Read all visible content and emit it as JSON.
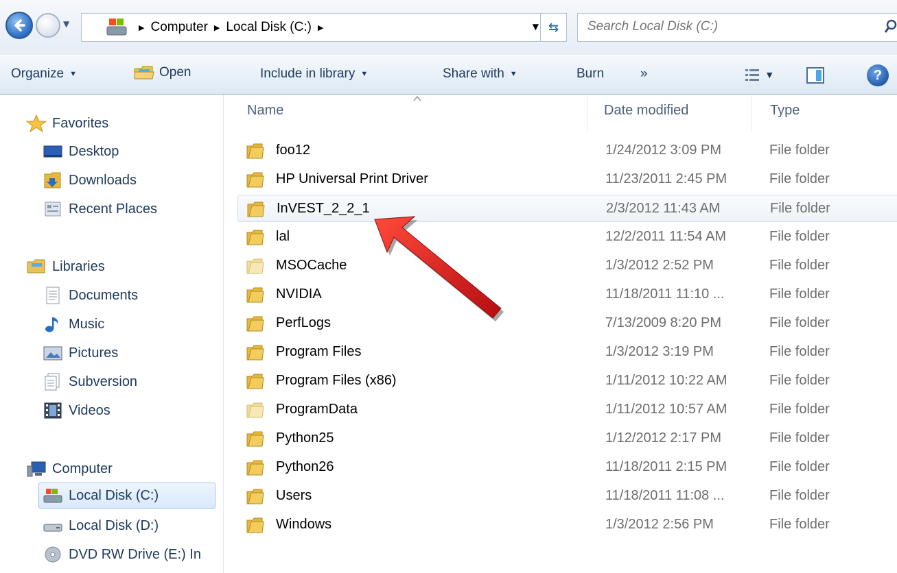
{
  "address_bar": {
    "breadcrumbs": [
      "Computer",
      "Local Disk (C:)"
    ],
    "search_placeholder": "Search Local Disk (C:)"
  },
  "toolbar": {
    "organize": "Organize",
    "open": "Open",
    "include_in_library": "Include in library",
    "share_with": "Share with",
    "burn": "Burn",
    "overflow": "»"
  },
  "nav_pane": {
    "favorites": {
      "label": "Favorites",
      "items": [
        {
          "label": "Desktop",
          "icon": "desktop-icon"
        },
        {
          "label": "Downloads",
          "icon": "downloads-icon"
        },
        {
          "label": "Recent Places",
          "icon": "recent-places-icon"
        }
      ]
    },
    "libraries": {
      "label": "Libraries",
      "items": [
        {
          "label": "Documents",
          "icon": "documents-icon"
        },
        {
          "label": "Music",
          "icon": "music-icon"
        },
        {
          "label": "Pictures",
          "icon": "pictures-icon"
        },
        {
          "label": "Subversion",
          "icon": "subversion-icon"
        },
        {
          "label": "Videos",
          "icon": "videos-icon"
        }
      ]
    },
    "computer": {
      "label": "Computer",
      "items": [
        {
          "label": "Local Disk (C:)",
          "icon": "local-disk-c-icon",
          "selected": true
        },
        {
          "label": "Local Disk (D:)",
          "icon": "local-disk-d-icon"
        },
        {
          "label": "DVD RW Drive (E:) In",
          "icon": "dvd-drive-icon"
        }
      ]
    }
  },
  "file_list": {
    "columns": [
      "Name",
      "Date modified",
      "Type"
    ],
    "rows": [
      {
        "name": "foo12",
        "date": "1/24/2012 3:09 PM",
        "type": "File folder"
      },
      {
        "name": "HP Universal Print Driver",
        "date": "11/23/2011 2:45 PM",
        "type": "File folder"
      },
      {
        "name": "InVEST_2_2_1",
        "date": "2/3/2012 11:43 AM",
        "type": "File folder"
      },
      {
        "name": "lal",
        "date": "12/2/2011 11:54 AM",
        "type": "File folder"
      },
      {
        "name": "MSOCache",
        "date": "1/3/2012 2:52 PM",
        "type": "File folder"
      },
      {
        "name": "NVIDIA",
        "date": "11/18/2011 11:10 ...",
        "type": "File folder"
      },
      {
        "name": "PerfLogs",
        "date": "7/13/2009 8:20 PM",
        "type": "File folder"
      },
      {
        "name": "Program Files",
        "date": "1/3/2012 3:19 PM",
        "type": "File folder"
      },
      {
        "name": "Program Files (x86)",
        "date": "1/11/2012 10:22 AM",
        "type": "File folder"
      },
      {
        "name": "ProgramData",
        "date": "1/11/2012 10:57 AM",
        "type": "File folder"
      },
      {
        "name": "Python25",
        "date": "1/12/2012 2:17 PM",
        "type": "File folder"
      },
      {
        "name": "Python26",
        "date": "11/18/2011 2:15 PM",
        "type": "File folder"
      },
      {
        "name": "Users",
        "date": "11/18/2011 11:08 ...",
        "type": "File folder"
      },
      {
        "name": "Windows",
        "date": "1/3/2012 2:56 PM",
        "type": "File folder"
      }
    ]
  },
  "colors": {
    "accent": "#2a6cc4",
    "annotation_arrow": "#d8141a",
    "folder": "#e8b83a"
  }
}
